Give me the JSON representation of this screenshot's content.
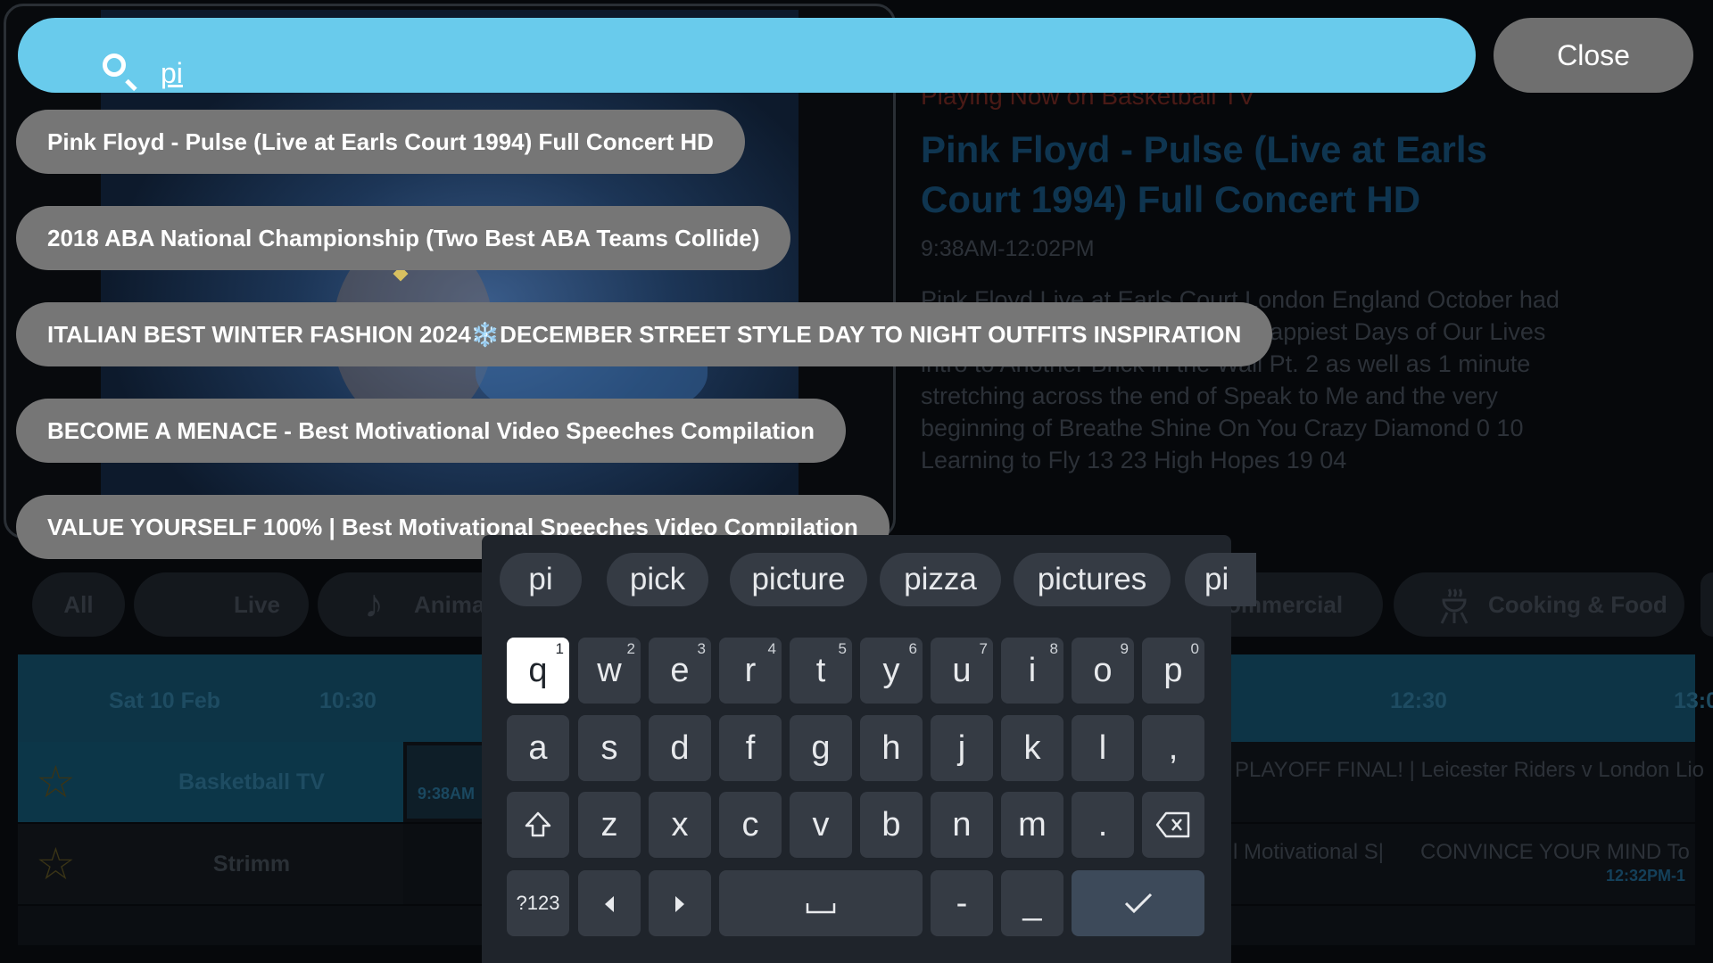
{
  "search": {
    "query": "pi",
    "close_label": "Close",
    "suggestions": [
      "Pink Floyd - Pulse (Live at Earls Court 1994) Full Concert HD",
      "2018 ABA National Championship (Two Best ABA Teams Collide)",
      "ITALIAN BEST WINTER FASHION 2024❄️DECEMBER STREET STYLE DAY TO NIGHT OUTFITS  INSPIRATION",
      "BECOME A MENACE - Best Motivational Video Speeches Compilation",
      "VALUE YOURSELF 100% | Best Motivational Speeches Video Compilation"
    ]
  },
  "now_playing": {
    "subtitle": "Playing Now on Basketball TV",
    "title": "Pink Floyd - Pulse (Live at Earls Court 1994) Full Concert HD",
    "time": "9:38AM-12:02PM",
    "description": "Pink Floyd Live at Earls Court London England October had to delete 20 seconds from The Happiest Days of Our Lives intro to Another Brick in the Wall Pt. 2 as well as 1 minute stretching across the end of Speak to Me and the very beginning of Breathe Shine On You Crazy Diamond 0 10 Learning to Fly 13 23 High Hopes 19 04"
  },
  "categories": [
    "All",
    "Live",
    "Anima",
    "ommercial",
    "Cooking & Food"
  ],
  "guide": {
    "date": "Sat 10 Feb",
    "times": [
      "10:30",
      "12:30",
      "13:0"
    ],
    "channels": [
      {
        "name": "Basketball TV",
        "program_time": "9:38AM",
        "program_right": "PLAYOFF FINAL! | Leicester Riders v London Lio"
      },
      {
        "name": "Strimm",
        "program_mid": "l Motivational S|",
        "program_right": "CONVINCE YOUR MIND To",
        "program_right_time": "12:32PM-1"
      }
    ]
  },
  "keyboard": {
    "candidates": [
      "pi",
      "pick",
      "picture",
      "pizza",
      "pictures",
      "pi"
    ],
    "row1": [
      "q",
      "w",
      "e",
      "r",
      "t",
      "y",
      "u",
      "i",
      "o",
      "p"
    ],
    "row1_hints": [
      "1",
      "2",
      "3",
      "4",
      "5",
      "6",
      "7",
      "8",
      "9",
      "0"
    ],
    "row2": [
      "a",
      "s",
      "d",
      "f",
      "g",
      "h",
      "j",
      "k",
      "l",
      ","
    ],
    "row3": [
      "z",
      "x",
      "c",
      "v",
      "b",
      "n",
      "m",
      "."
    ],
    "symbols_label": "?123",
    "dash": "-",
    "underscore": "_",
    "active_key": "q"
  },
  "colors": {
    "search_bar": "#69cbec",
    "suggestion_pill": "#767676",
    "keyboard_bg": "#1f242b",
    "key_bg": "#353b44",
    "enter_key": "#3d4a5a"
  }
}
